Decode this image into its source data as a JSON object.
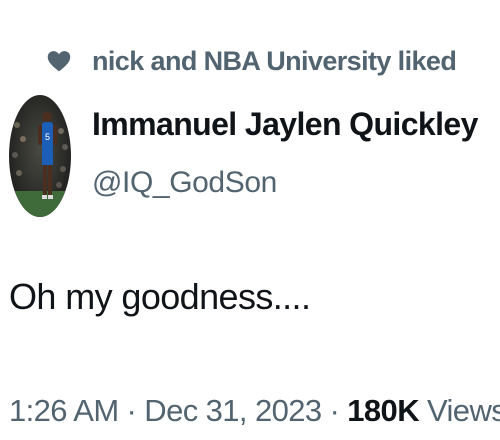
{
  "social_context": {
    "icon": "heart-icon",
    "text": "nick and NBA University liked"
  },
  "author": {
    "display_name": "Immanuel Jaylen Quickley",
    "handle": "@IQ_GodSon",
    "avatar": "avatar-photo-basketball-player"
  },
  "tweet": {
    "text": "Oh my goodness...."
  },
  "meta": {
    "time": "1:26 AM",
    "separator": " · ",
    "date": "Dec 31, 2023",
    "views_count": "180K",
    "views_label": " Views"
  },
  "colors": {
    "primary_text": "#0f1419",
    "secondary_text": "#536471",
    "background": "#ffffff"
  }
}
